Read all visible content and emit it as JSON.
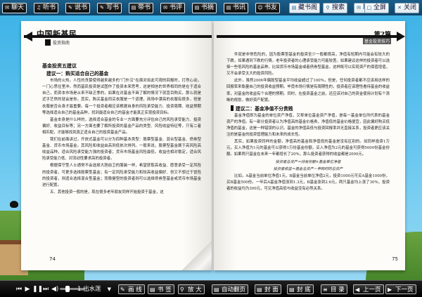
{
  "toolbar": {
    "left_buttons": [
      {
        "label": "聊天",
        "icon": "chat-icon",
        "glyph": "✉"
      },
      {
        "label": "听书",
        "icon": "headphone-icon",
        "glyph": "♫"
      },
      {
        "label": "说书",
        "icon": "speak-icon",
        "glyph": "✎"
      },
      {
        "label": "写书",
        "icon": "pen-icon",
        "glyph": "✎"
      },
      {
        "label": "带书",
        "icon": "bag-icon",
        "glyph": "▤"
      },
      {
        "label": "书评",
        "icon": "comment-icon",
        "glyph": "✉"
      },
      {
        "label": "书摘",
        "icon": "note-icon",
        "glyph": "▤"
      },
      {
        "label": "书讯",
        "icon": "info-icon",
        "glyph": "▤"
      },
      {
        "label": "书友",
        "icon": "friends-icon",
        "glyph": "☺"
      }
    ],
    "right_buttons": [
      {
        "label": "藏书阁",
        "icon": "bookshelf-icon",
        "glyph": "▤"
      },
      {
        "label": "搜索",
        "icon": "search-icon",
        "glyph": "⚲"
      },
      {
        "label": "联系",
        "icon": "mail-icon",
        "glyph": "✉"
      },
      {
        "label": "全屏",
        "icon": "fullscreen-icon",
        "glyph": "□"
      },
      {
        "label": "关闭",
        "icon": "close-icon",
        "glyph": "✕"
      }
    ]
  },
  "book": {
    "left_page": {
      "header_name": "中国新基民",
      "header_sub": "投资指南",
      "section_title": "基金投资五建议",
      "subsection1": "建议一：购买适合自己的基金",
      "paragraphs": [
        "市场的火热，人性的贪婪使得越来越多的“门外汉”在面对如此可观的回报时，打然心动，一门心思往里冲。然而基民投资是试图作了投资未来思考，这是相信的世界相同的是在于适合自己，而资本市场是从来不缺乏季的，如果在对基金不具了解的情况下就盲目购买，那么就是近乎茫然的就会是你。其实，购买基金同买衣服是一个道理，商场中漂亮的衣服有很多，但是衣服是否合身才最重要。每一个投资者都应该根据自身的风险承受能力、投资周期、收益预期等选择适合自己的基金品种，找到最适合自己的基金才能真正实现投资目标。",
        "基金本身是什么样的，选择适合基金的专业一方面要充分评估自己的风险承受能力、投资偏好、收益目标等；另一方面也要了解所投资的基金产品的类型、风险收益特征等，只有二者相匹配，才能够找到真正适合自己的投资基金产品。",
        "我们在前面讲过，开放式基金可以分为四种基本类型：股票型基金、混合型基金、债券型基金、货币市场基金。其风险和收益由高到低依次排列。一般来说，股票型基金属于高风险高收益品种，适合风险承受能力强的投资者；货币市场基金风险最低，收益也相对稳定，适合风险承受能力低、对流动性要求高的投资者。",
        "根据保守型人士通常不会选择大胆前卫的服装一样，希望获取高收益、愿意承受一定风险的投资者，可更多选择股票型基金；有一定风险承受能力和较高收益偏好、但又不想过于冒险的投资者，则适合选择混合型基金；而稳健型的投资者则可以选择债券型基金或货币市场基金进行配置。",
        "五、其他投资一般的是，现在很多老年朋友同样开始投资于基金，这"
      ],
      "page_number": "74"
    },
    "right_page": {
      "chapter": "第2篇",
      "chapter_sub": "基金投资技巧",
      "paragraphs_top": [
        "件就是非常危险的，因为股票型基金的投资至少一般都很高，净值有短期内可能会有较大的下跌，如果遇到下跌的行情，老年投资者的心理承受能力可能较差。如果建议这样的投资者可以选择一些低风险的基金品种，比如货币市场基金或者债券型基金，这样既可以实现资产的保值增值，又不会承受太大的投资风险。",
        "此外，虽然2006年偏股型基金平均收益超过了100%，但是，任何投资者都不应该用这样的回报率来衡量自己的投资收益预期。毕竟市场行情是有周期性的，投资者应该理性看待基金的收益率，对基金的收益有个合理的预期。同时，在投资基金之前，还应该对自己的资金使用计划有个清晰的规划，做好资产配置。"
      ],
      "subsection2": "建议二：基金净值不分贵贱",
      "paragraphs_bottom": [
        "基金净值即为基金的单位资产净值，又称单位基金资产净值，是每一基金单位所代表的基金资产的净值。有一部分投资者认为净值高的基金价格贵，净值低的基金价格便宜，因此偏好购买低净值的基金，这是一种错误的认识。基金的净值高低与投资回报率并无直接关系，投资者更应该关注的是基金的投资管理能力和未来的成长性。",
        "其实，如果投资同样的金额，净值高的基金和净值低的基金是没有区别的。如同样投资1万元，买入净值为1元的基金可以获得1万份基金份额，买入净值为2元的基金可获得5000份基金份额。如果两只基金在未来一年都增长了20%，那么投资者获得的收益都是2000元。"
      ],
      "formula1": "投资者总资产＝持有份额×基金单位净值",
      "formula2": "投资者收益＝基金总资产－申购时的总资产",
      "paragraphs_end": [
        "比如，A基金当前单位净值1元，B基金当前单位净值2元，投资1000元可买A基金1000份，买B基金500份。一年后A基金净值涨到1.3元，B基金涨到2.6元，两只基金均上涨了30%，投资者的收益均为300元，可见净值高低与收益没有必然关系。"
      ],
      "page_number": "75"
    }
  },
  "bottombar": {
    "playback_icons": [
      "first-page-icon",
      "play-icon",
      "pause-icon",
      "last-page-icon",
      "volume-icon"
    ],
    "music_select": "1.出水莲",
    "buttons": [
      {
        "label": "画 线",
        "icon": "draw-icon",
        "glyph": "✎"
      },
      {
        "label": "书 签",
        "icon": "bookmark-icon",
        "glyph": "▤"
      },
      {
        "label": "放 大",
        "icon": "zoom-icon",
        "glyph": "⚲"
      },
      {
        "label": "自动翻页",
        "icon": "autoflip-icon",
        "glyph": "▤"
      },
      {
        "label": "封 面",
        "icon": "cover-icon",
        "glyph": "▤"
      },
      {
        "label": "封 底",
        "icon": "backcover-icon",
        "glyph": "▤"
      },
      {
        "label": "目 录",
        "icon": "toc-icon",
        "glyph": "≡"
      },
      {
        "label": "上一页",
        "icon": "prev-icon",
        "glyph": "◀"
      },
      {
        "label": "下一页",
        "icon": "next-icon",
        "glyph": "▶"
      }
    ]
  }
}
